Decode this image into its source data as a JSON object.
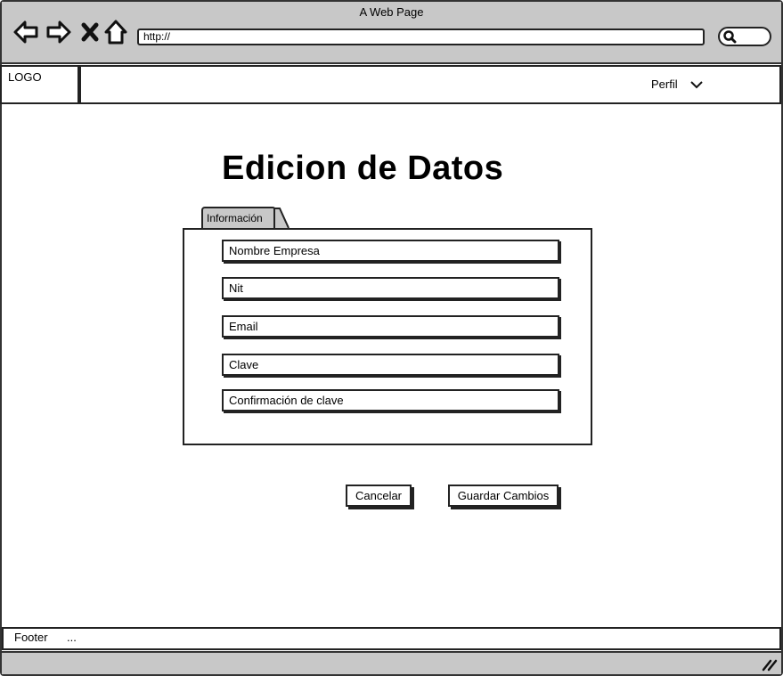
{
  "browser": {
    "window_title": "A Web Page",
    "url": "http://",
    "icons": [
      "back-arrow-icon",
      "forward-arrow-icon",
      "close-x-icon",
      "home-icon",
      "search-icon"
    ]
  },
  "header": {
    "logo": "LOGO",
    "profile_label": "Perfil"
  },
  "main": {
    "title": "Edicion de Datos",
    "tab_label": "Información",
    "fields": [
      {
        "placeholder": "Nombre Empresa"
      },
      {
        "placeholder": "Nit"
      },
      {
        "placeholder": "Email"
      },
      {
        "placeholder": "Clave"
      },
      {
        "placeholder": "Confirmación de clave"
      }
    ],
    "buttons": {
      "cancel": "Cancelar",
      "save": "Guardar Cambios"
    }
  },
  "footer": {
    "label": "Footer",
    "extra": "..."
  },
  "colors": {
    "chrome_gray": "#c8c8c8",
    "border": "#222222"
  }
}
